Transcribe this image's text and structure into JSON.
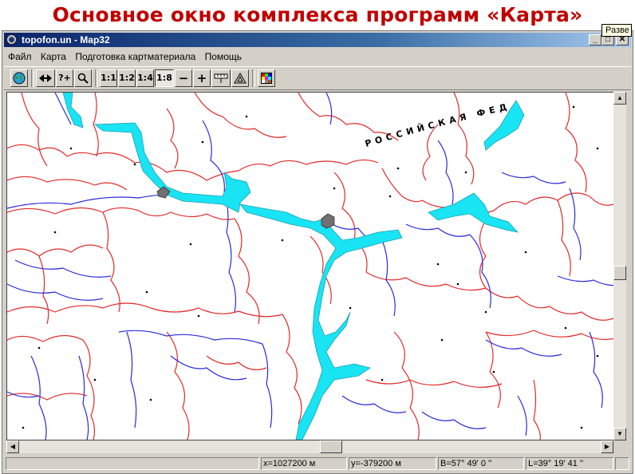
{
  "slide_title": "Основное окно комплекса программ «Карта»",
  "window": {
    "title": "topofon.un - Map32",
    "minimize_label": "_",
    "maximize_label": "□",
    "close_label": "✕"
  },
  "menu": [
    "Файл",
    "Карта",
    "Подготовка картматериала",
    "Помощь"
  ],
  "tooltip": "Разве",
  "toolbar": {
    "scale_1_1": "1:1",
    "scale_1_2": "1:2",
    "scale_1_4": "1:4",
    "scale_1_8": "1:8",
    "zoom_out": "−",
    "zoom_in": "+",
    "query_label": "?+"
  },
  "map": {
    "country_label": "РОССИЙСКАЯ  ФЕД",
    "colors": {
      "water": "#19e4f4",
      "river": "#2b2bd9",
      "border": "#e02a2a",
      "settlement": "#707070"
    }
  },
  "status": {
    "x": "x=1027200 м",
    "y": "y=-379200 м",
    "b": "B=57° 49' 0 ''",
    "l": "L=39° 19' 41 ''"
  }
}
